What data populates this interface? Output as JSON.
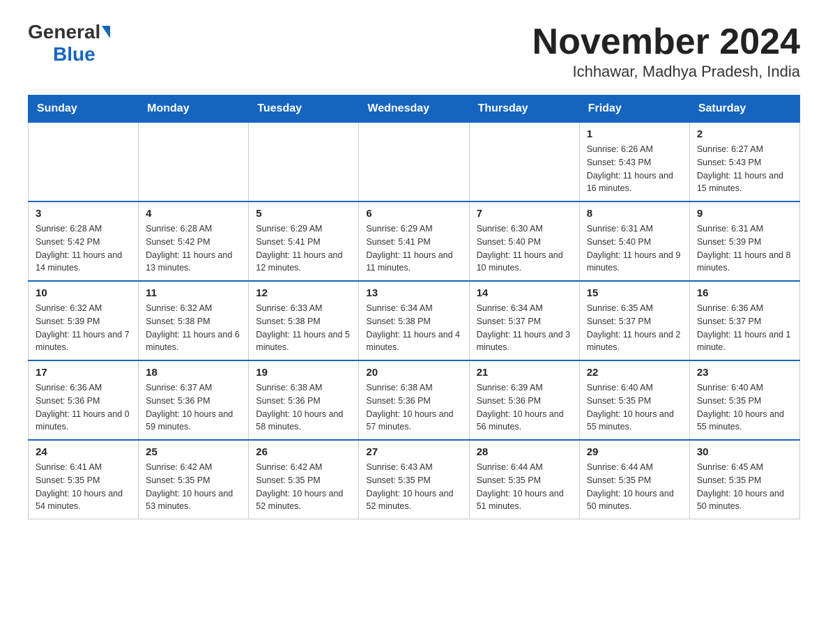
{
  "header": {
    "logo_general": "General",
    "logo_blue": "Blue",
    "title": "November 2024",
    "subtitle": "Ichhawar, Madhya Pradesh, India"
  },
  "days_of_week": [
    "Sunday",
    "Monday",
    "Tuesday",
    "Wednesday",
    "Thursday",
    "Friday",
    "Saturday"
  ],
  "weeks": [
    {
      "days": [
        {
          "number": "",
          "info": ""
        },
        {
          "number": "",
          "info": ""
        },
        {
          "number": "",
          "info": ""
        },
        {
          "number": "",
          "info": ""
        },
        {
          "number": "",
          "info": ""
        },
        {
          "number": "1",
          "info": "Sunrise: 6:26 AM\nSunset: 5:43 PM\nDaylight: 11 hours and 16 minutes."
        },
        {
          "number": "2",
          "info": "Sunrise: 6:27 AM\nSunset: 5:43 PM\nDaylight: 11 hours and 15 minutes."
        }
      ]
    },
    {
      "days": [
        {
          "number": "3",
          "info": "Sunrise: 6:28 AM\nSunset: 5:42 PM\nDaylight: 11 hours and 14 minutes."
        },
        {
          "number": "4",
          "info": "Sunrise: 6:28 AM\nSunset: 5:42 PM\nDaylight: 11 hours and 13 minutes."
        },
        {
          "number": "5",
          "info": "Sunrise: 6:29 AM\nSunset: 5:41 PM\nDaylight: 11 hours and 12 minutes."
        },
        {
          "number": "6",
          "info": "Sunrise: 6:29 AM\nSunset: 5:41 PM\nDaylight: 11 hours and 11 minutes."
        },
        {
          "number": "7",
          "info": "Sunrise: 6:30 AM\nSunset: 5:40 PM\nDaylight: 11 hours and 10 minutes."
        },
        {
          "number": "8",
          "info": "Sunrise: 6:31 AM\nSunset: 5:40 PM\nDaylight: 11 hours and 9 minutes."
        },
        {
          "number": "9",
          "info": "Sunrise: 6:31 AM\nSunset: 5:39 PM\nDaylight: 11 hours and 8 minutes."
        }
      ]
    },
    {
      "days": [
        {
          "number": "10",
          "info": "Sunrise: 6:32 AM\nSunset: 5:39 PM\nDaylight: 11 hours and 7 minutes."
        },
        {
          "number": "11",
          "info": "Sunrise: 6:32 AM\nSunset: 5:38 PM\nDaylight: 11 hours and 6 minutes."
        },
        {
          "number": "12",
          "info": "Sunrise: 6:33 AM\nSunset: 5:38 PM\nDaylight: 11 hours and 5 minutes."
        },
        {
          "number": "13",
          "info": "Sunrise: 6:34 AM\nSunset: 5:38 PM\nDaylight: 11 hours and 4 minutes."
        },
        {
          "number": "14",
          "info": "Sunrise: 6:34 AM\nSunset: 5:37 PM\nDaylight: 11 hours and 3 minutes."
        },
        {
          "number": "15",
          "info": "Sunrise: 6:35 AM\nSunset: 5:37 PM\nDaylight: 11 hours and 2 minutes."
        },
        {
          "number": "16",
          "info": "Sunrise: 6:36 AM\nSunset: 5:37 PM\nDaylight: 11 hours and 1 minute."
        }
      ]
    },
    {
      "days": [
        {
          "number": "17",
          "info": "Sunrise: 6:36 AM\nSunset: 5:36 PM\nDaylight: 11 hours and 0 minutes."
        },
        {
          "number": "18",
          "info": "Sunrise: 6:37 AM\nSunset: 5:36 PM\nDaylight: 10 hours and 59 minutes."
        },
        {
          "number": "19",
          "info": "Sunrise: 6:38 AM\nSunset: 5:36 PM\nDaylight: 10 hours and 58 minutes."
        },
        {
          "number": "20",
          "info": "Sunrise: 6:38 AM\nSunset: 5:36 PM\nDaylight: 10 hours and 57 minutes."
        },
        {
          "number": "21",
          "info": "Sunrise: 6:39 AM\nSunset: 5:36 PM\nDaylight: 10 hours and 56 minutes."
        },
        {
          "number": "22",
          "info": "Sunrise: 6:40 AM\nSunset: 5:35 PM\nDaylight: 10 hours and 55 minutes."
        },
        {
          "number": "23",
          "info": "Sunrise: 6:40 AM\nSunset: 5:35 PM\nDaylight: 10 hours and 55 minutes."
        }
      ]
    },
    {
      "days": [
        {
          "number": "24",
          "info": "Sunrise: 6:41 AM\nSunset: 5:35 PM\nDaylight: 10 hours and 54 minutes."
        },
        {
          "number": "25",
          "info": "Sunrise: 6:42 AM\nSunset: 5:35 PM\nDaylight: 10 hours and 53 minutes."
        },
        {
          "number": "26",
          "info": "Sunrise: 6:42 AM\nSunset: 5:35 PM\nDaylight: 10 hours and 52 minutes."
        },
        {
          "number": "27",
          "info": "Sunrise: 6:43 AM\nSunset: 5:35 PM\nDaylight: 10 hours and 52 minutes."
        },
        {
          "number": "28",
          "info": "Sunrise: 6:44 AM\nSunset: 5:35 PM\nDaylight: 10 hours and 51 minutes."
        },
        {
          "number": "29",
          "info": "Sunrise: 6:44 AM\nSunset: 5:35 PM\nDaylight: 10 hours and 50 minutes."
        },
        {
          "number": "30",
          "info": "Sunrise: 6:45 AM\nSunset: 5:35 PM\nDaylight: 10 hours and 50 minutes."
        }
      ]
    }
  ]
}
